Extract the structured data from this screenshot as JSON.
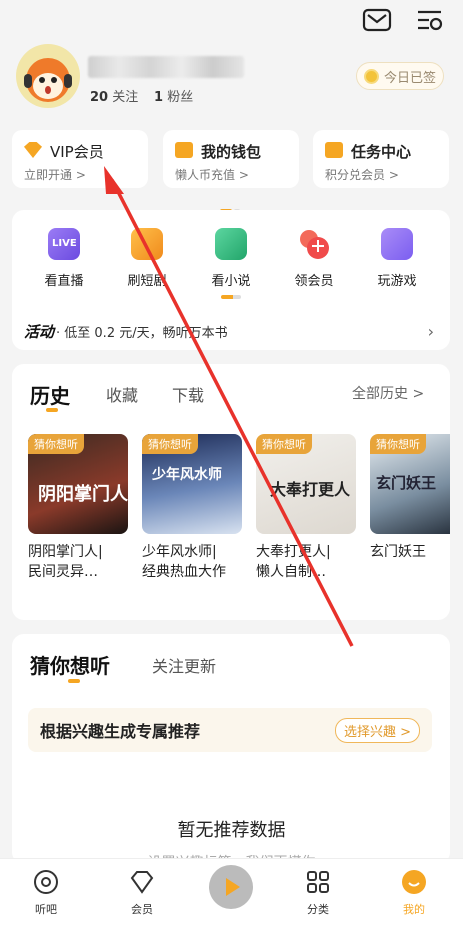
{
  "header": {
    "mail_icon": "mail-icon",
    "settings_icon": "settings-icon"
  },
  "profile": {
    "following_count": "20",
    "following_label": "关注",
    "followers_count": "1",
    "followers_label": "粉丝",
    "checkin_label": "今日已签"
  },
  "cards": [
    {
      "title": "VIP会员",
      "subtitle": "立即开通 >"
    },
    {
      "title": "我的钱包",
      "subtitle": "懒人币充值 >"
    },
    {
      "title": "任务中心",
      "subtitle": "积分兑会员 >"
    }
  ],
  "entries": [
    {
      "label": "看直播",
      "icon": "live-icon"
    },
    {
      "label": "刷短剧",
      "icon": "short-drama-icon"
    },
    {
      "label": "看小说",
      "icon": "novel-icon"
    },
    {
      "label": "领会员",
      "icon": "member-gift-icon"
    },
    {
      "label": "玩游戏",
      "icon": "gamepad-icon"
    }
  ],
  "promo": {
    "tag": "活动",
    "text": "· 低至 0.2 元/天，畅听万本书"
  },
  "history": {
    "tabs": [
      "历史",
      "收藏",
      "下载"
    ],
    "all_label": "全部历史 >",
    "badge": "猜你想听",
    "books": [
      {
        "title_line1": "阴阳掌门人|",
        "title_line2": "民间灵异…",
        "cover_text": "阴阳掌门人"
      },
      {
        "title_line1": "少年风水师|",
        "title_line2": "经典热血大作",
        "cover_text": "少年风水师"
      },
      {
        "title_line1": "大奉打更人|",
        "title_line2": "懒人自制…",
        "cover_text": "大奉打更人"
      },
      {
        "title_line1": "玄门妖王",
        "title_line2": "",
        "cover_text": "玄门妖王"
      }
    ]
  },
  "recommend": {
    "tabs": [
      "猜你想听",
      "关注更新"
    ],
    "interest_text": "根据兴趣生成专属推荐",
    "interest_button": "选择兴趣 >",
    "empty_text": "暂无推荐数据",
    "empty_sub": "设置兴趣标签，我们更懂你"
  },
  "tabbar": [
    {
      "label": "听吧",
      "icon": "listen-icon"
    },
    {
      "label": "会员",
      "icon": "vip-icon"
    },
    {
      "label": "",
      "icon": "play-icon"
    },
    {
      "label": "分类",
      "icon": "category-icon"
    },
    {
      "label": "我的",
      "icon": "mine-icon"
    }
  ],
  "colors": {
    "accent": "#f5a623",
    "arrow": "#e8322b"
  }
}
